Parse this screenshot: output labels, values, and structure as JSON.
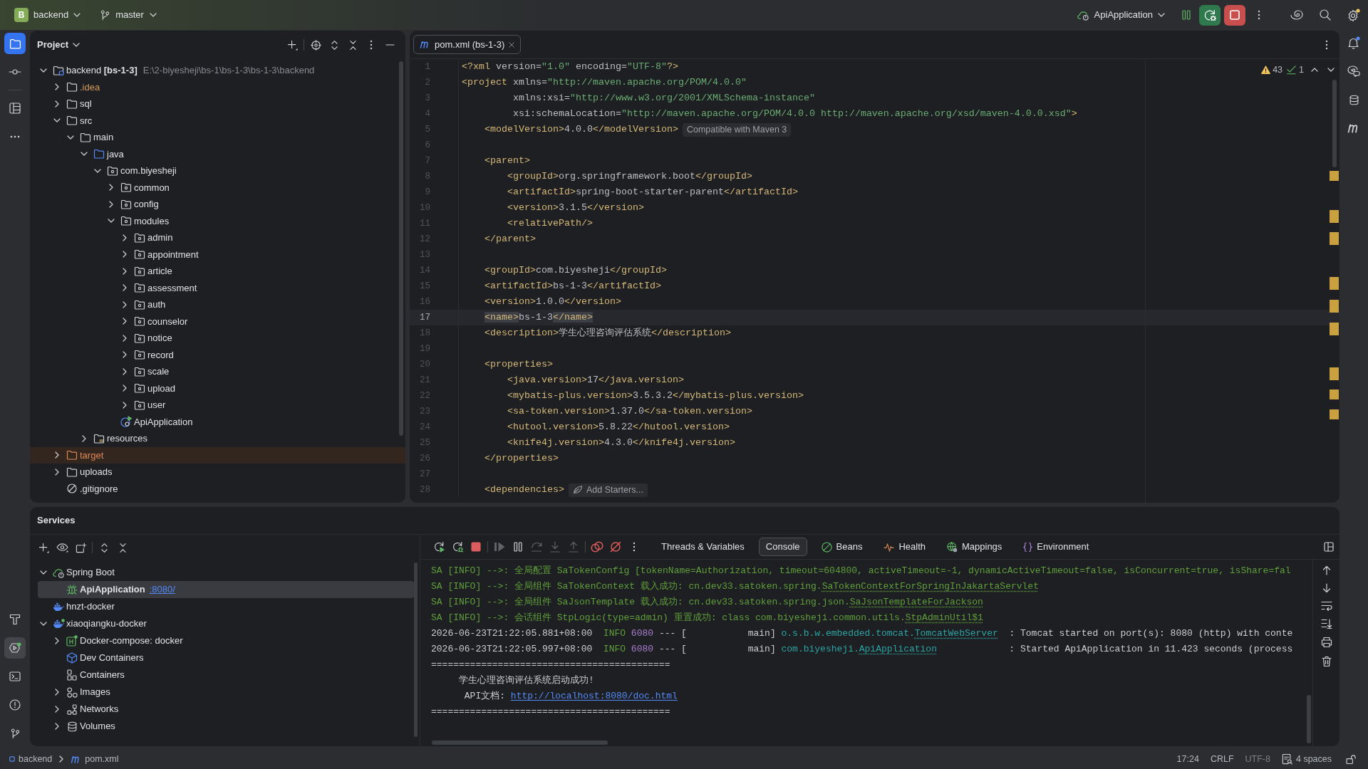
{
  "title_bar": {
    "project_badge": "B",
    "project": "backend",
    "branch": "master",
    "run_configuration": "ApiApplication"
  },
  "left_toolbar": {
    "top": [
      {
        "kind": "project",
        "selected": true,
        "focused": true
      },
      {
        "kind": "commit",
        "selected": false,
        "focused": false
      },
      {
        "kind": "structure",
        "selected": false,
        "focused": false
      },
      {
        "kind": "more",
        "selected": false,
        "focused": false
      }
    ],
    "bottom": [
      {
        "kind": "build",
        "selected": false,
        "focused": false
      },
      {
        "kind": "services",
        "selected": true,
        "focused": false
      },
      {
        "kind": "terminal",
        "selected": false,
        "focused": false
      },
      {
        "kind": "problems",
        "selected": false,
        "focused": false
      },
      {
        "kind": "git",
        "selected": false,
        "focused": false
      }
    ]
  },
  "project_panel": {
    "title": "Project",
    "tree": [
      {
        "label": "backend **[bs-1-3]**",
        "path": "E:\\2-biyesheji\\bs-1\\bs-1-3\\bs-1-3\\backend",
        "kind": "module",
        "expanded": true,
        "children": [
          {
            "label": ".idea",
            "kind": "ignored",
            "expanded": false
          },
          {
            "label": "sql",
            "kind": "folder",
            "expanded": false
          },
          {
            "label": "src",
            "kind": "folder",
            "expanded": true,
            "children": [
              {
                "label": "main",
                "kind": "folder",
                "expanded": true,
                "children": [
                  {
                    "label": "java",
                    "kind": "source",
                    "expanded": true,
                    "children": [
                      {
                        "label": "com.biyesheji",
                        "kind": "package",
                        "expanded": true,
                        "children": [
                          {
                            "label": "common",
                            "kind": "package",
                            "expanded": false
                          },
                          {
                            "label": "config",
                            "kind": "package",
                            "expanded": false
                          },
                          {
                            "label": "modules",
                            "kind": "package",
                            "expanded": true,
                            "children": [
                              {
                                "label": "admin",
                                "kind": "package",
                                "expanded": false
                              },
                              {
                                "label": "appointment",
                                "kind": "package",
                                "expanded": false
                              },
                              {
                                "label": "article",
                                "kind": "package",
                                "expanded": false
                              },
                              {
                                "label": "assessment",
                                "kind": "package",
                                "expanded": false
                              },
                              {
                                "label": "auth",
                                "kind": "package",
                                "expanded": false
                              },
                              {
                                "label": "counselor",
                                "kind": "package",
                                "expanded": false
                              },
                              {
                                "label": "notice",
                                "kind": "package",
                                "expanded": false
                              },
                              {
                                "label": "record",
                                "kind": "package",
                                "expanded": false
                              },
                              {
                                "label": "scale",
                                "kind": "package",
                                "expanded": false
                              },
                              {
                                "label": "upload",
                                "kind": "package",
                                "expanded": false
                              },
                              {
                                "label": "user",
                                "kind": "package",
                                "expanded": false
                              }
                            ]
                          },
                          {
                            "label": "ApiApplication",
                            "kind": "spring-class"
                          }
                        ]
                      }
                    ]
                  },
                  {
                    "label": "resources",
                    "kind": "resources",
                    "expanded": false
                  }
                ]
              }
            ]
          },
          {
            "label": "target",
            "kind": "excluded",
            "expanded": false
          },
          {
            "label": "uploads",
            "kind": "folder",
            "expanded": false
          },
          {
            "label": ".gitignore",
            "kind": "ignore-file"
          }
        ]
      }
    ]
  },
  "editor": {
    "tabs": [
      {
        "label": "pom.xml (bs-1-3)",
        "selected": true
      }
    ],
    "inspections": {
      "warnings": "43",
      "checks": "1"
    },
    "lines": [
      {
        "number": "1",
        "current": false,
        "tokens": [
          {
            "kind": "tag",
            "text": "<?xml"
          },
          {
            "kind": "text",
            "text": " version="
          },
          {
            "kind": "value",
            "text": "\"1.0\""
          },
          {
            "kind": "text",
            "text": " encoding="
          },
          {
            "kind": "value",
            "text": "\"UTF-8\""
          },
          {
            "kind": "tag",
            "text": "?>"
          }
        ]
      },
      {
        "number": "2",
        "current": false,
        "tokens": [
          {
            "kind": "tag",
            "text": "<project"
          },
          {
            "kind": "text",
            "text": " xmlns="
          },
          {
            "kind": "value",
            "text": "\"http://maven.apache.org/POM/4.0.0\""
          }
        ]
      },
      {
        "number": "3",
        "current": false,
        "tokens": [
          {
            "kind": "text",
            "text": "         xmlns:xsi="
          },
          {
            "kind": "value",
            "text": "\"http://www.w3.org/2001/XMLSchema-instance\""
          }
        ]
      },
      {
        "number": "4",
        "current": false,
        "tokens": [
          {
            "kind": "text",
            "text": "         xsi:schemaLocation="
          },
          {
            "kind": "value",
            "text": "\"http://maven.apache.org/POM/4.0.0 http://maven.apache.org/xsd/maven-4.0.0.xsd\""
          },
          {
            "kind": "tag",
            "text": ">"
          }
        ]
      },
      {
        "number": "5",
        "current": false,
        "tokens": [
          {
            "kind": "tag",
            "text": "    <modelVersion>"
          },
          {
            "kind": "text",
            "text": "4.0.0"
          },
          {
            "kind": "tag",
            "text": "</modelVersion>"
          }
        ],
        "hint": {
          "kind": "info",
          "text": "Compatible with Maven 3"
        }
      },
      {
        "number": "6",
        "current": false
      },
      {
        "number": "7",
        "current": false,
        "tokens": [
          {
            "kind": "tag",
            "text": "    <parent>"
          }
        ]
      },
      {
        "number": "8",
        "current": false,
        "tokens": [
          {
            "kind": "tag",
            "text": "        <groupId>"
          },
          {
            "kind": "text",
            "text": "org.springframework.boot"
          },
          {
            "kind": "tag",
            "text": "</groupId>"
          }
        ]
      },
      {
        "number": "9",
        "current": false,
        "tokens": [
          {
            "kind": "tag",
            "text": "        <artifactId>"
          },
          {
            "kind": "text",
            "text": "spring-boot-starter-parent"
          },
          {
            "kind": "tag",
            "text": "</artifactId>"
          }
        ]
      },
      {
        "number": "10",
        "current": false,
        "tokens": [
          {
            "kind": "tag",
            "text": "        <version>"
          },
          {
            "kind": "text",
            "text": "3.1.5"
          },
          {
            "kind": "tag",
            "text": "</version>"
          }
        ]
      },
      {
        "number": "11",
        "current": false,
        "tokens": [
          {
            "kind": "tag",
            "text": "        <relativePath/>"
          }
        ]
      },
      {
        "number": "12",
        "current": false,
        "tokens": [
          {
            "kind": "tag",
            "text": "    </parent>"
          }
        ]
      },
      {
        "number": "13",
        "current": false
      },
      {
        "number": "14",
        "current": false,
        "tokens": [
          {
            "kind": "tag",
            "text": "    <groupId>"
          },
          {
            "kind": "text",
            "text": "com.biyesheji"
          },
          {
            "kind": "tag",
            "text": "</groupId>"
          }
        ]
      },
      {
        "number": "15",
        "current": false,
        "tokens": [
          {
            "kind": "tag",
            "text": "    <artifactId>"
          },
          {
            "kind": "text",
            "text": "bs-1-3"
          },
          {
            "kind": "tag",
            "text": "</artifactId>"
          }
        ]
      },
      {
        "number": "16",
        "current": false,
        "tokens": [
          {
            "kind": "tag",
            "text": "    <version>"
          },
          {
            "kind": "text",
            "text": "1.0.0"
          },
          {
            "kind": "tag",
            "text": "</version>"
          }
        ]
      },
      {
        "number": "17",
        "current": true,
        "tokens": [
          {
            "kind": "match",
            "text": "    <name>"
          },
          {
            "kind": "text",
            "text": "bs-1-3"
          },
          {
            "kind": "match",
            "text": "</name>"
          }
        ]
      },
      {
        "number": "18",
        "current": false,
        "tokens": [
          {
            "kind": "tag",
            "text": "    <description>"
          },
          {
            "kind": "text",
            "text": "学生心理咨询评估系统"
          },
          {
            "kind": "tag",
            "text": "</description>"
          }
        ]
      },
      {
        "number": "19",
        "current": false
      },
      {
        "number": "20",
        "current": false,
        "tokens": [
          {
            "kind": "tag",
            "text": "    <properties>"
          }
        ]
      },
      {
        "number": "21",
        "current": false,
        "tokens": [
          {
            "kind": "tag",
            "text": "        <java.version>"
          },
          {
            "kind": "text",
            "text": "17"
          },
          {
            "kind": "tag",
            "text": "</java.version>"
          }
        ]
      },
      {
        "number": "22",
        "current": false,
        "tokens": [
          {
            "kind": "tag",
            "text": "        <mybatis-plus.version>"
          },
          {
            "kind": "text",
            "text": "3.5.3.2"
          },
          {
            "kind": "tag",
            "text": "</mybatis-plus.version>"
          }
        ]
      },
      {
        "number": "23",
        "current": false,
        "tokens": [
          {
            "kind": "tag",
            "text": "        <sa-token.version>"
          },
          {
            "kind": "text",
            "text": "1.37.0"
          },
          {
            "kind": "tag",
            "text": "</sa-token.version>"
          }
        ]
      },
      {
        "number": "24",
        "current": false,
        "tokens": [
          {
            "kind": "tag",
            "text": "        <hutool.version>"
          },
          {
            "kind": "text",
            "text": "5.8.22"
          },
          {
            "kind": "tag",
            "text": "</hutool.version>"
          }
        ]
      },
      {
        "number": "25",
        "current": false,
        "tokens": [
          {
            "kind": "tag",
            "text": "        <knife4j.version>"
          },
          {
            "kind": "text",
            "text": "4.3.0"
          },
          {
            "kind": "tag",
            "text": "</knife4j.version>"
          }
        ]
      },
      {
        "number": "26",
        "current": false,
        "tokens": [
          {
            "kind": "tag",
            "text": "    </properties>"
          }
        ]
      },
      {
        "number": "27",
        "current": false
      },
      {
        "number": "28",
        "current": false,
        "tokens": [
          {
            "kind": "tag",
            "text": "    <dependencies>"
          }
        ],
        "hint": {
          "kind": "action",
          "text": "Add Starters..."
        }
      }
    ]
  },
  "right_toolbar": [
    {
      "kind": "notifications",
      "selected": false
    },
    {
      "kind": "ai-chat",
      "selected": false
    },
    {
      "kind": "database",
      "selected": false
    },
    {
      "kind": "maven",
      "selected": false
    }
  ],
  "services_panel": {
    "title": "Services",
    "tree": [
      {
        "label": "Spring Boot",
        "kind": "spring-boot",
        "expanded": true,
        "selected": false,
        "children": [
          {
            "label": "ApiApplication",
            "kind": "running-app",
            "selected": true,
            "port": ":8080/"
          }
        ]
      },
      {
        "label": "hnzt-docker",
        "kind": "docker",
        "selected": false
      },
      {
        "label": "xiaoqiangku-docker",
        "kind": "docker-connected",
        "expanded": true,
        "selected": false,
        "children": [
          {
            "label": "Docker-compose: docker",
            "kind": "compose",
            "expanded": false,
            "selected": false
          },
          {
            "label": "Dev Containers",
            "kind": "dev-containers",
            "selected": false
          },
          {
            "label": "Containers",
            "kind": "containers",
            "selected": false
          },
          {
            "label": "Images",
            "kind": "images",
            "expanded": false,
            "selected": false
          },
          {
            "label": "Networks",
            "kind": "networks",
            "expanded": false,
            "selected": false
          },
          {
            "label": "Volumes",
            "kind": "volumes",
            "expanded": false,
            "selected": false
          }
        ]
      }
    ],
    "debug_toolbar": [
      [
        {
          "kind": "rerun",
          "disabled": false
        },
        {
          "kind": "rerun-debug",
          "disabled": false
        },
        {
          "kind": "stop",
          "disabled": false
        }
      ],
      [
        {
          "kind": "resume",
          "disabled": true
        },
        {
          "kind": "pause",
          "disabled": false
        },
        {
          "kind": "step-over",
          "disabled": true
        },
        {
          "kind": "step-into",
          "disabled": true
        },
        {
          "kind": "step-out",
          "disabled": true
        }
      ],
      [
        {
          "kind": "breakpoints",
          "disabled": false
        },
        {
          "kind": "mute-breakpoints",
          "disabled": false
        },
        {
          "kind": "more",
          "disabled": false
        }
      ]
    ],
    "tabs": [
      {
        "label": "Threads & Variables",
        "kind": "plain",
        "selected": false
      },
      {
        "label": "Console",
        "kind": "plain",
        "selected": true
      },
      {
        "label": "Beans",
        "kind": "beans",
        "selected": false
      },
      {
        "label": "Health",
        "kind": "health",
        "selected": false
      },
      {
        "label": "Mappings",
        "kind": "mappings",
        "selected": false
      },
      {
        "label": "Environment",
        "kind": "environment",
        "selected": false
      }
    ],
    "console": [
      {
        "segments": [
          {
            "kind": "sa",
            "text": "SA [INFO] -->: 全局配置 SaTokenConfig [tokenName=Authorization, timeout=604800, activeTimeout=-1, dynamicActiveTimeout=false, isConcurrent=true, isShare=fal"
          }
        ]
      },
      {
        "segments": [
          {
            "kind": "sa",
            "text": "SA [INFO] -->: 全局组件 SaTokenContext 载入成功: cn.dev33.satoken.spring."
          },
          {
            "kind": "sa-ref",
            "text": "SaTokenContextForSpringInJakartaServlet"
          }
        ]
      },
      {
        "segments": [
          {
            "kind": "sa",
            "text": "SA [INFO] -->: 全局组件 SaJsonTemplate 载入成功: cn.dev33.satoken.spring.json."
          },
          {
            "kind": "sa-ref",
            "text": "SaJsonTemplateForJackson"
          }
        ]
      },
      {
        "segments": [
          {
            "kind": "sa",
            "text": "SA [INFO] -->: 会话组件 StpLogic(type=admin) 重置成功: class com.biyesheji.common.utils."
          },
          {
            "kind": "sa-ref",
            "text": "StpAdminUtil$1"
          }
        ]
      },
      {
        "segments": [
          {
            "kind": "plain",
            "text": "2026-06-23T21:22:05.881+08:00  "
          },
          {
            "kind": "info",
            "text": "INFO"
          },
          {
            "kind": "pid",
            "text": " 6080"
          },
          {
            "kind": "plain",
            "text": " --- [           main] "
          },
          {
            "kind": "logger",
            "text": "o.s.b.w.embedded.tomcat."
          },
          {
            "kind": "logger-ref",
            "text": "TomcatWebServer"
          },
          {
            "kind": "plain",
            "text": "  : Tomcat started on port(s): 8080 (http) with conte"
          }
        ]
      },
      {
        "segments": [
          {
            "kind": "plain",
            "text": "2026-06-23T21:22:05.997+08:00  "
          },
          {
            "kind": "info",
            "text": "INFO"
          },
          {
            "kind": "pid",
            "text": " 6080"
          },
          {
            "kind": "plain",
            "text": " --- [           main] "
          },
          {
            "kind": "logger",
            "text": "com.biyesheji."
          },
          {
            "kind": "logger-ref",
            "text": "ApiApplication"
          },
          {
            "kind": "plain",
            "text": "             : Started ApiApplication in 11.423 seconds (process"
          }
        ]
      },
      {
        "segments": [
          {
            "kind": "plain",
            "text": "==========================================="
          }
        ]
      },
      {
        "segments": [
          {
            "kind": "plain",
            "text": "     学生心理咨询评估系统启动成功!"
          }
        ]
      },
      {
        "segments": [
          {
            "kind": "plain",
            "text": "      API文档: "
          },
          {
            "kind": "link",
            "text": "http://localhost:8080/doc.html"
          }
        ]
      },
      {
        "segments": [
          {
            "kind": "plain",
            "text": "==========================================="
          }
        ]
      }
    ]
  },
  "status_bar": {
    "breadcrumbs": [
      {
        "label": "backend",
        "kind": "module"
      },
      {
        "label": "pom.xml",
        "kind": "maven-file"
      }
    ],
    "widgets": [
      {
        "text": "17:24",
        "kind": "text",
        "disabled": false
      },
      {
        "text": "CRLF",
        "kind": "text",
        "disabled": false
      },
      {
        "text": "UTF-8",
        "kind": "text",
        "disabled": true
      },
      {
        "text": "4 spaces",
        "kind": "indent",
        "disabled": false
      }
    ]
  }
}
